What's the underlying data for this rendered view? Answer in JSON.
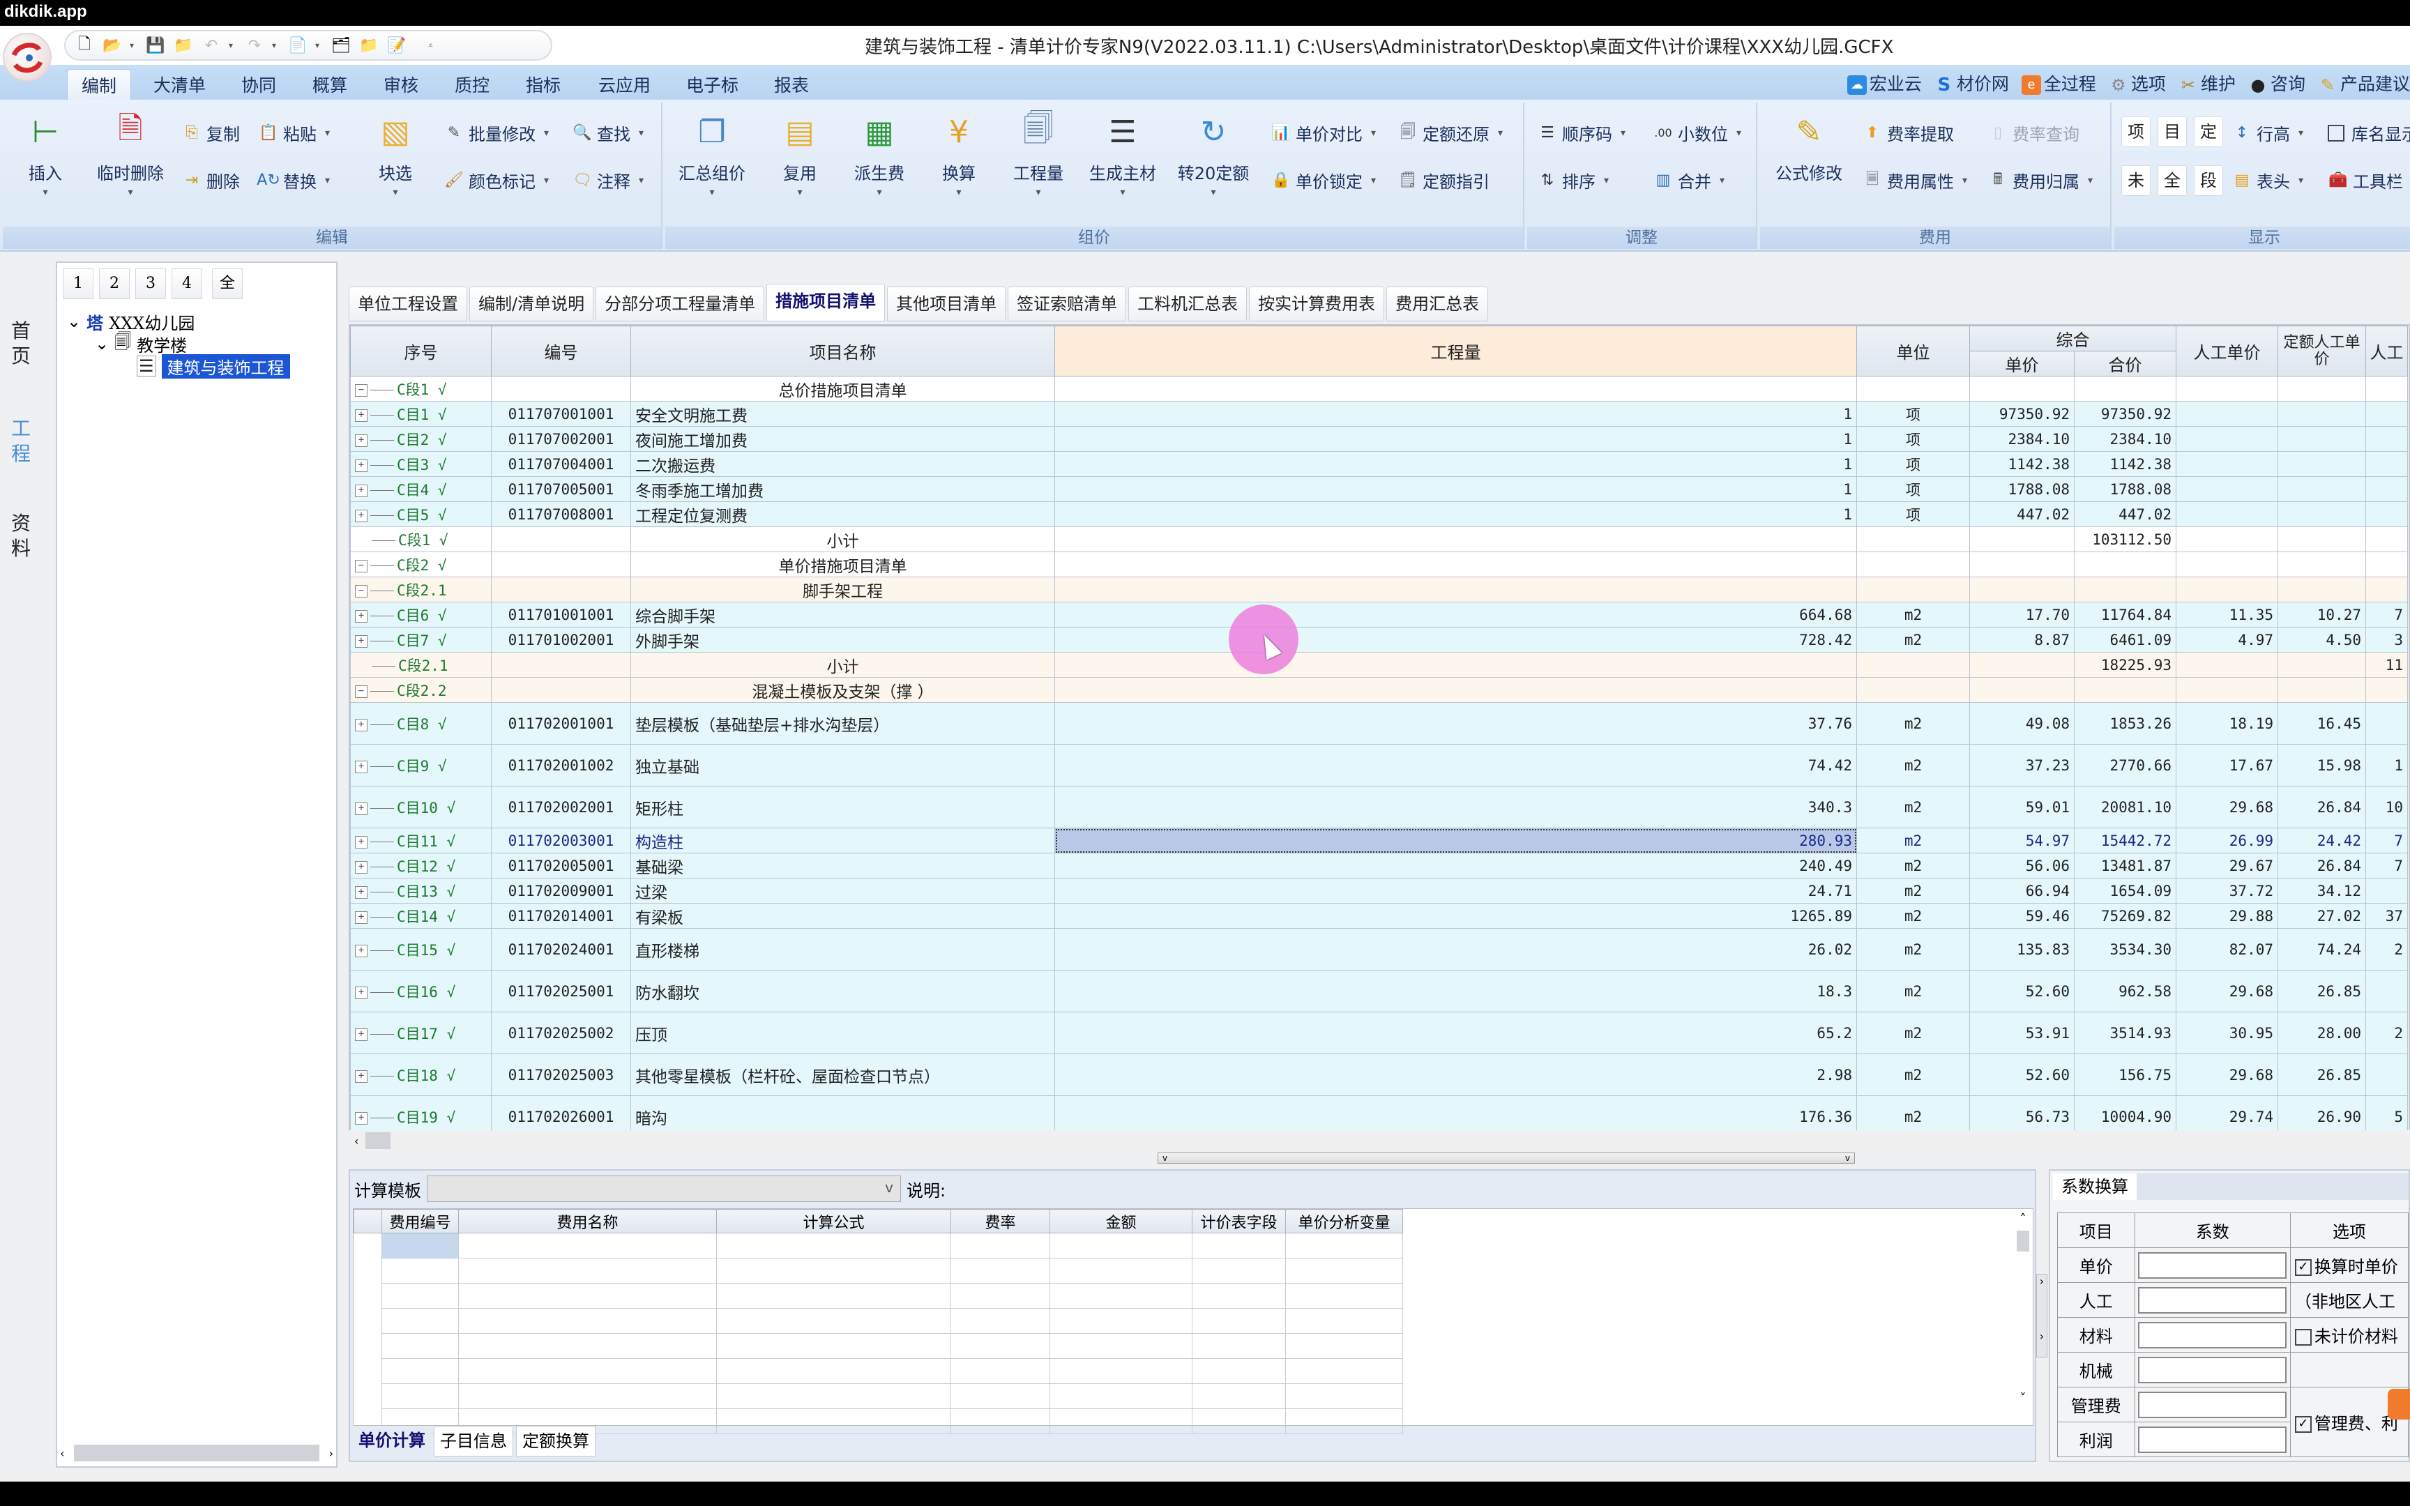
{
  "watermark": "dikdik.app",
  "window": {
    "title": "建筑与装饰工程 - 清单计价专家N9(V2022.03.11.1) C:\\Users\\Administrator\\Desktop\\桌面文件\\计价课程\\XXX幼儿园.GCFX"
  },
  "ribbon_tabs": [
    "编制",
    "大清单",
    "协同",
    "概算",
    "审核",
    "质控",
    "指标",
    "云应用",
    "电子标",
    "报表"
  ],
  "active_ribbon_tab": "编制",
  "top_tools": [
    "宏业云",
    "材价网",
    "全过程",
    "选项",
    "维护",
    "咨询",
    "产品建议"
  ],
  "ribbon": {
    "edit": {
      "label": "编辑",
      "insert": "插入",
      "temp_delete": "临时删除",
      "copy": "复制",
      "paste": "粘贴",
      "delete": "删除",
      "replace": "替换",
      "block_select": "块选",
      "batch_modify": "批量修改",
      "find": "查找",
      "color_mark": "颜色标记",
      "annotate": "注释"
    },
    "pricing": {
      "label": "组价",
      "summary_price": "汇总组价",
      "reuse": "复用",
      "derived_fee": "派生费",
      "convert": "换算",
      "quantity": "工程量",
      "gen_material": "生成主材",
      "to20_quota": "转20定额",
      "unit_price_compare": "单价对比",
      "quota_restore": "定额还原",
      "unit_price_lock": "单价锁定",
      "quota_guide": "定额指引"
    },
    "adjust": {
      "label": "调整",
      "seq_code": "顺序码",
      "decimals": "小数位",
      "sort": "排序",
      "merge": "合并"
    },
    "fee": {
      "label": "费用",
      "formula_edit": "公式修改",
      "rate_fetch": "费率提取",
      "rate_query": "费率查询",
      "fee_attr": "费用属性",
      "fee_belong": "费用归属"
    },
    "display": {
      "label": "显示",
      "btn_item": "项",
      "btn_mu": "目",
      "btn_ding": "定",
      "btn_wei": "未",
      "btn_quan": "全",
      "btn_duan": "段",
      "row_height": "行高",
      "lib_name": "库名显示",
      "header": "表头",
      "toolbar": "工具栏"
    }
  },
  "left_nav": {
    "home": "首页",
    "project": "工程",
    "docs": "资料"
  },
  "level_buttons": [
    "1",
    "2",
    "3",
    "4",
    "全"
  ],
  "tree": {
    "root": "XXX幼儿园",
    "building": "教学楼",
    "unit": "建筑与装饰工程"
  },
  "main_tabs": [
    "单位工程设置",
    "编制/清单说明",
    "分部分项工程量清单",
    "措施项目清单",
    "其他项目清单",
    "签证索赔清单",
    "工料机汇总表",
    "按实计算费用表",
    "费用汇总表"
  ],
  "active_main_tab": "措施项目清单",
  "grid": {
    "headers": {
      "seq": "序号",
      "code": "编号",
      "name": "项目名称",
      "qty": "工程量",
      "unit": "单位",
      "composite": "综合",
      "unit_price": "单价",
      "total": "合价",
      "labor_price": "人工单价",
      "quota_labor_price": "定额人工单价",
      "labor_more": "人工"
    },
    "rows": [
      {
        "type": "sec",
        "exp": "-",
        "seq": "C段1 √",
        "code": "",
        "name": "总价措施项目清单",
        "qty": "",
        "unit": "",
        "up": "",
        "total": "",
        "lp": "",
        "qlp": "",
        "extra": ""
      },
      {
        "type": "item",
        "exp": "+",
        "seq": "C目1 √",
        "code": "011707001001",
        "name": "安全文明施工费",
        "qty": "1",
        "unit": "项",
        "up": "97350.92",
        "total": "97350.92",
        "lp": "",
        "qlp": "",
        "extra": ""
      },
      {
        "type": "item",
        "exp": "+",
        "seq": "C目2 √",
        "code": "011707002001",
        "name": "夜间施工增加费",
        "qty": "1",
        "unit": "项",
        "up": "2384.10",
        "total": "2384.10",
        "lp": "",
        "qlp": "",
        "extra": ""
      },
      {
        "type": "item",
        "exp": "+",
        "seq": "C目3 √",
        "code": "011707004001",
        "name": "二次搬运费",
        "qty": "1",
        "unit": "项",
        "up": "1142.38",
        "total": "1142.38",
        "lp": "",
        "qlp": "",
        "extra": ""
      },
      {
        "type": "item",
        "exp": "+",
        "seq": "C目4 √",
        "code": "011707005001",
        "name": "冬雨季施工增加费",
        "qty": "1",
        "unit": "项",
        "up": "1788.08",
        "total": "1788.08",
        "lp": "",
        "qlp": "",
        "extra": ""
      },
      {
        "type": "item",
        "exp": "+",
        "seq": "C目5 √",
        "code": "011707008001",
        "name": "工程定位复测费",
        "qty": "1",
        "unit": "项",
        "up": "447.02",
        "total": "447.02",
        "lp": "",
        "qlp": "",
        "extra": ""
      },
      {
        "type": "sec",
        "exp": "",
        "seq": "C段1 √",
        "code": "",
        "name": "小计",
        "qty": "",
        "unit": "",
        "up": "",
        "total": "103112.50",
        "lp": "",
        "qlp": "",
        "extra": ""
      },
      {
        "type": "sec",
        "exp": "-",
        "seq": "C段2 √",
        "code": "",
        "name": "单价措施项目清单",
        "qty": "",
        "unit": "",
        "up": "",
        "total": "",
        "lp": "",
        "qlp": "",
        "extra": ""
      },
      {
        "type": "sub",
        "exp": "-",
        "seq": "C段2.1",
        "code": "",
        "name": "脚手架工程",
        "qty": "",
        "unit": "",
        "up": "",
        "total": "",
        "lp": "",
        "qlp": "",
        "extra": ""
      },
      {
        "type": "item",
        "exp": "+",
        "seq": "C目6 √",
        "code": "011701001001",
        "name": "综合脚手架",
        "qty": "664.68",
        "unit": "m2",
        "up": "17.70",
        "total": "11764.84",
        "lp": "11.35",
        "qlp": "10.27",
        "extra": "7"
      },
      {
        "type": "item",
        "exp": "+",
        "seq": "C目7 √",
        "code": "011701002001",
        "name": "外脚手架",
        "qty": "728.42",
        "unit": "m2",
        "up": "8.87",
        "total": "6461.09",
        "lp": "4.97",
        "qlp": "4.50",
        "extra": "3"
      },
      {
        "type": "sub",
        "exp": "",
        "seq": "C段2.1",
        "code": "",
        "name": "小计",
        "qty": "",
        "unit": "",
        "up": "",
        "total": "18225.93",
        "lp": "",
        "qlp": "",
        "extra": "11"
      },
      {
        "type": "sub",
        "exp": "-",
        "seq": "C段2.2",
        "code": "",
        "name": "混凝土模板及支架（撑 ）",
        "qty": "",
        "unit": "",
        "up": "",
        "total": "",
        "lp": "",
        "qlp": "",
        "extra": ""
      },
      {
        "type": "item tall",
        "exp": "+",
        "seq": "C目8 √",
        "code": "011702001001",
        "name": "垫层模板（基础垫层+排水沟垫层）",
        "qty": "37.76",
        "unit": "m2",
        "up": "49.08",
        "total": "1853.26",
        "lp": "18.19",
        "qlp": "16.45",
        "extra": ""
      },
      {
        "type": "item tall",
        "exp": "+",
        "seq": "C目9 √",
        "code": "011702001002",
        "name": "独立基础",
        "qty": "74.42",
        "unit": "m2",
        "up": "37.23",
        "total": "2770.66",
        "lp": "17.67",
        "qlp": "15.98",
        "extra": "1"
      },
      {
        "type": "item tall",
        "exp": "+",
        "seq": "C目10 √",
        "code": "011702002001",
        "name": "矩形柱",
        "qty": "340.3",
        "unit": "m2",
        "up": "59.01",
        "total": "20081.10",
        "lp": "29.68",
        "qlp": "26.84",
        "extra": "10"
      },
      {
        "type": "item selrow",
        "exp": "+",
        "seq": "C目11 √",
        "code": "011702003001",
        "name": "构造柱",
        "qty": "280.93",
        "unit": "m2",
        "up": "54.97",
        "total": "15442.72",
        "lp": "26.99",
        "qlp": "24.42",
        "extra": "7"
      },
      {
        "type": "item",
        "exp": "+",
        "seq": "C目12 √",
        "code": "011702005001",
        "name": "基础梁",
        "qty": "240.49",
        "unit": "m2",
        "up": "56.06",
        "total": "13481.87",
        "lp": "29.67",
        "qlp": "26.84",
        "extra": "7"
      },
      {
        "type": "item",
        "exp": "+",
        "seq": "C目13 √",
        "code": "011702009001",
        "name": "过梁",
        "qty": "24.71",
        "unit": "m2",
        "up": "66.94",
        "total": "1654.09",
        "lp": "37.72",
        "qlp": "34.12",
        "extra": ""
      },
      {
        "type": "item",
        "exp": "+",
        "seq": "C目14 √",
        "code": "011702014001",
        "name": "有梁板",
        "qty": "1265.89",
        "unit": "m2",
        "up": "59.46",
        "total": "75269.82",
        "lp": "29.88",
        "qlp": "27.02",
        "extra": "37"
      },
      {
        "type": "item tall",
        "exp": "+",
        "seq": "C目15 √",
        "code": "011702024001",
        "name": "直形楼梯",
        "qty": "26.02",
        "unit": "m2",
        "up": "135.83",
        "total": "3534.30",
        "lp": "82.07",
        "qlp": "74.24",
        "extra": "2"
      },
      {
        "type": "item tall",
        "exp": "+",
        "seq": "C目16 √",
        "code": "011702025001",
        "name": "防水翻坎",
        "qty": "18.3",
        "unit": "m2",
        "up": "52.60",
        "total": "962.58",
        "lp": "29.68",
        "qlp": "26.85",
        "extra": ""
      },
      {
        "type": "item tall",
        "exp": "+",
        "seq": "C目17 √",
        "code": "011702025002",
        "name": "压顶",
        "qty": "65.2",
        "unit": "m2",
        "up": "53.91",
        "total": "3514.93",
        "lp": "30.95",
        "qlp": "28.00",
        "extra": "2"
      },
      {
        "type": "item tall",
        "exp": "+",
        "seq": "C目18 √",
        "code": "011702025003",
        "name": "其他零星模板（栏杆砼、屋面检查口节点）",
        "qty": "2.98",
        "unit": "m2",
        "up": "52.60",
        "total": "156.75",
        "lp": "29.68",
        "qlp": "26.85",
        "extra": ""
      },
      {
        "type": "item tall",
        "exp": "+",
        "seq": "C目19 √",
        "code": "011702026001",
        "name": "暗沟",
        "qty": "176.36",
        "unit": "m2",
        "up": "56.73",
        "total": "10004.90",
        "lp": "29.74",
        "qlp": "26.90",
        "extra": "5"
      }
    ],
    "selected_cell_row": 16
  },
  "bottom": {
    "calc_template_label": "计算模板",
    "calc_template_value": "",
    "note_label": "说明:",
    "fee_headers": [
      "费用编号",
      "费用名称",
      "计算公式",
      "费率",
      "金额",
      "计价表字段",
      "单价分析变量"
    ],
    "tabs": [
      "单价计算",
      "子目信息",
      "定额换算"
    ],
    "active_tab": "单价计算"
  },
  "coef": {
    "title": "系数换算",
    "headers": [
      "项目",
      "系数",
      "选项"
    ],
    "rows": [
      "单价",
      "人工",
      "材料",
      "机械",
      "管理费",
      "利润"
    ],
    "opt_unit_price": "换算时单价",
    "opt_unit_price_checked": true,
    "opt_labor_note": "（非地区人工",
    "opt_unpriced": "未计价材料",
    "opt_unpriced_checked": false,
    "opt_mgmt": "管理费、利",
    "opt_mgmt_checked": true
  }
}
